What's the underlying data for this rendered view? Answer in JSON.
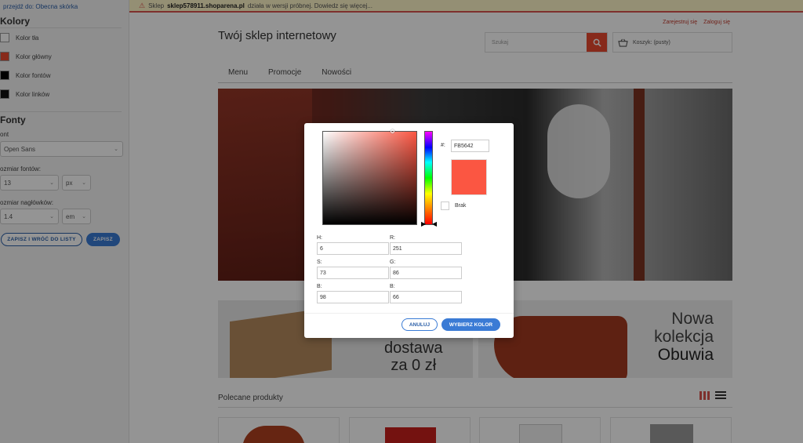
{
  "sidebar": {
    "back_link": "przejdź do: Obecna skórka",
    "colors_heading": "Kolory",
    "color_items": [
      {
        "label": "Kolor tła",
        "color": "#ffffff"
      },
      {
        "label": "Kolor główny",
        "color": "#fb5642"
      },
      {
        "label": "Kolor fontów",
        "color": "#000000"
      },
      {
        "label": "Kolor linków",
        "color": "#111111"
      }
    ],
    "fonts_heading": "Fonty",
    "font_label": "ont",
    "font_value": "Open Sans",
    "font_size_label": "ozmiar fontów:",
    "font_size_value": "13",
    "font_size_unit": "px",
    "heading_size_label": "ozmiar nagłówków:",
    "heading_size_value": "1.4",
    "heading_size_unit": "em",
    "save_return_label": "ZAPISZ I WRÓĆ DO LISTY",
    "save_label": "ZAPISZ"
  },
  "shop": {
    "banner_prefix": "Sklep",
    "banner_domain": "sklep578911.shoparena.pl",
    "banner_suffix": "działa w wersji próbnej. Dowiedz się więcej...",
    "register_link": "Zarejestruj się",
    "login_link": "Zaloguj się",
    "title": "Twój sklep internetowy",
    "search_placeholder": "Szukaj",
    "cart_label": "Koszyk: (pusty)",
    "nav": [
      "Menu",
      "Promocje",
      "Nowości"
    ],
    "promo1_lines": [
      "dostawa",
      "za 0 zł"
    ],
    "promo2_lines": [
      "Nowa",
      "kolekcja",
      "Obuwia"
    ],
    "featured_title": "Polecane produkty"
  },
  "color_picker": {
    "hex_label": "#:",
    "hex_value": "FB5642",
    "selected_color": "#fb5642",
    "none_label": "Brak",
    "h_label": "H:",
    "h_value": "6",
    "s_label": "S:",
    "s_value": "73",
    "b_label": "B:",
    "b_value": "98",
    "r_label": "R:",
    "r_value": "251",
    "g_label": "G:",
    "g_value": "86",
    "b2_label": "B:",
    "b2_value": "66",
    "cancel_label": "ANULUJ",
    "choose_label": "WYBIERZ KOLOR"
  }
}
